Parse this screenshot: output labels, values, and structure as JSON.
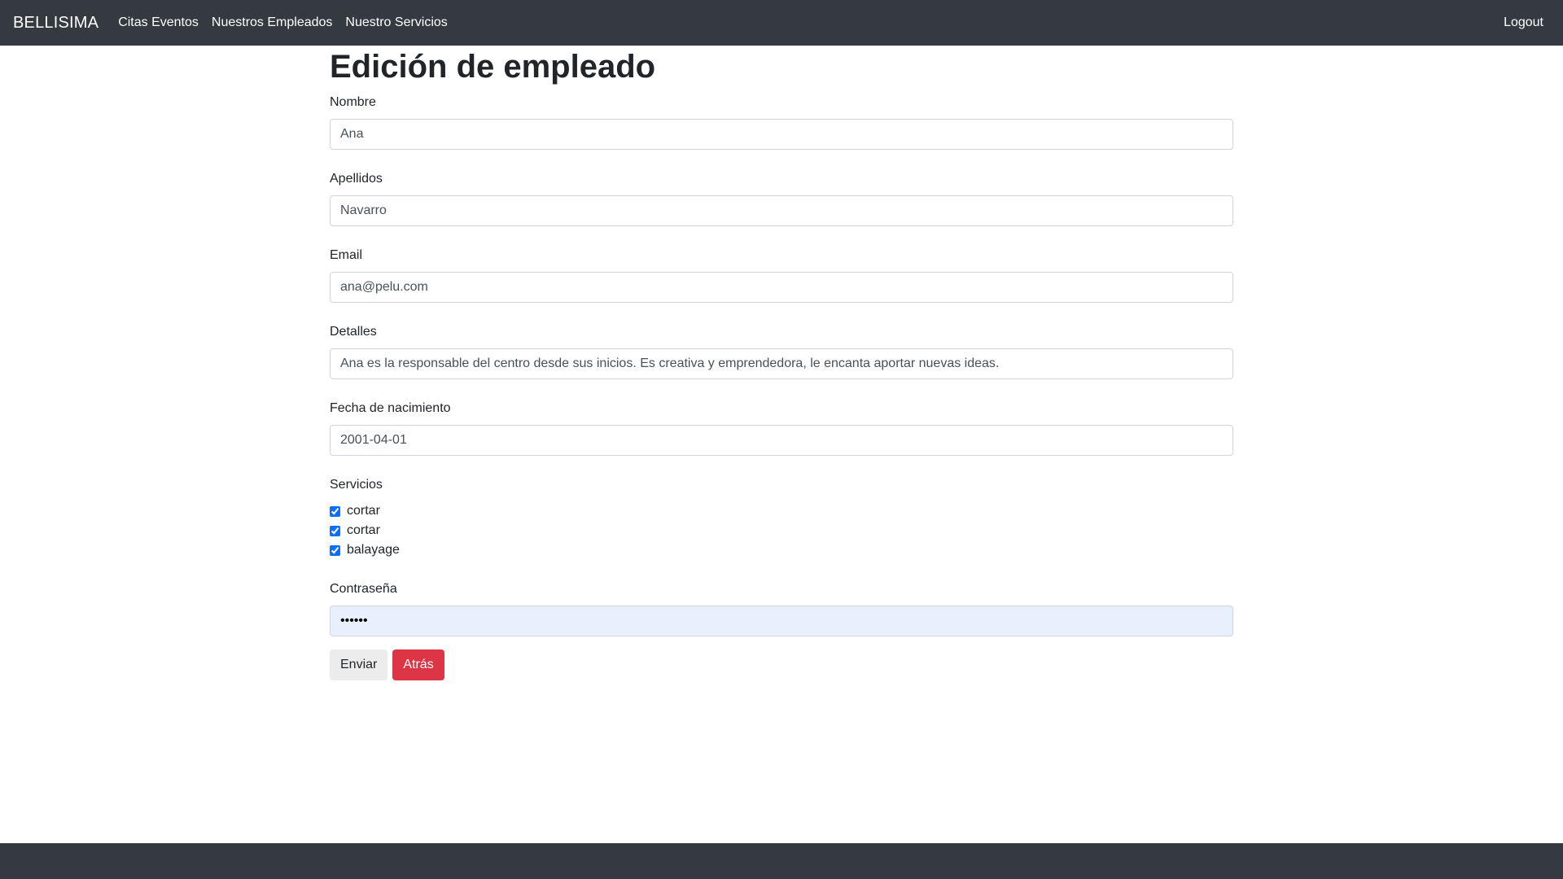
{
  "navbar": {
    "brand": "BELLISIMA",
    "links": [
      "Citas Eventos",
      "Nuestros Empleados",
      "Nuestro Servicios"
    ],
    "logout": "Logout"
  },
  "page": {
    "title": "Edición de empleado"
  },
  "form": {
    "nombre": {
      "label": "Nombre",
      "value": "Ana"
    },
    "apellidos": {
      "label": "Apellidos",
      "value": "Navarro"
    },
    "email": {
      "label": "Email",
      "value": "ana@pelu.com"
    },
    "detalles": {
      "label": "Detalles",
      "value": "Ana es la responsable del centro desde sus inicios. Es creativa y emprendedora, le encanta aportar nuevas ideas."
    },
    "fecha": {
      "label": "Fecha de nacimiento",
      "value": "2001-04-01"
    },
    "servicios": {
      "label": "Servicios",
      "items": [
        {
          "label": "cortar",
          "checked": true
        },
        {
          "label": "cortar",
          "checked": true
        },
        {
          "label": "balayage",
          "checked": true
        }
      ]
    },
    "password": {
      "label": "Contraseña",
      "value": "••••••"
    },
    "buttons": {
      "submit": "Enviar",
      "back": "Atrás"
    }
  },
  "colors": {
    "navbar": "#343a40",
    "danger": "#dc3545",
    "checkbox": "#0d6efd"
  }
}
